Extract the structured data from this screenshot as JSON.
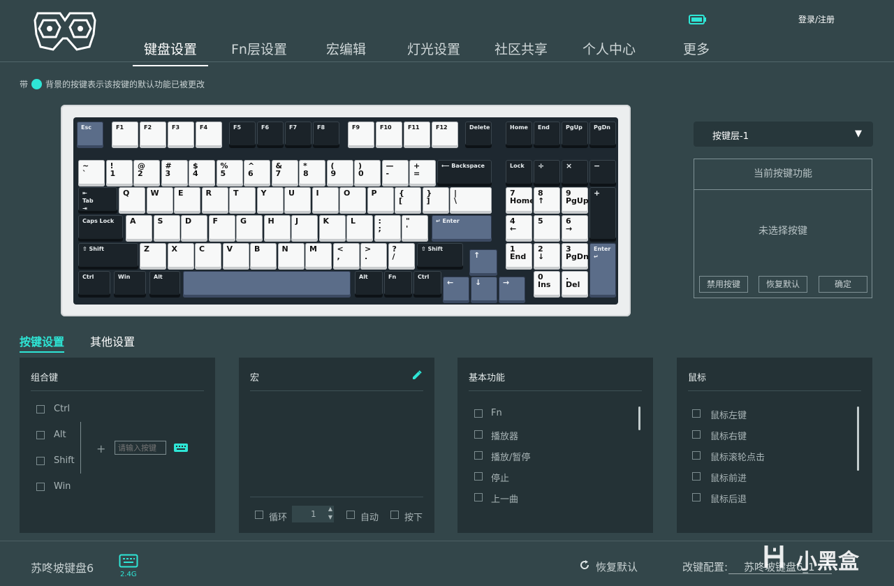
{
  "header": {
    "tabs": [
      {
        "label": "键盘设置",
        "active": true
      },
      {
        "label": "Fn层设置",
        "active": false
      },
      {
        "label": "宏编辑",
        "active": false
      },
      {
        "label": "灯光设置",
        "active": false
      },
      {
        "label": "社区共享",
        "active": false
      },
      {
        "label": "个人中心",
        "active": false
      },
      {
        "label": "更多",
        "active": false
      }
    ],
    "login": "登录/注册",
    "battery_icon": "battery-icon",
    "logo_icon": "logo-icon"
  },
  "notice": {
    "prefix": "带",
    "text": "背景的按键表示该按键的默认功能已被更改"
  },
  "keyboard": {
    "row_f": [
      "Esc",
      "F1",
      "F2",
      "F3",
      "F4",
      "F5",
      "F6",
      "F7",
      "F8",
      "F9",
      "F10",
      "F11",
      "F12",
      "Delete",
      "Home",
      "End",
      "PgUp",
      "PgDn"
    ],
    "row_num": [
      "~\n`",
      "!\n1",
      "@\n2",
      "#\n3",
      "$\n4",
      "%\n5",
      "^\n6",
      "&\n7",
      "*\n8",
      "(\n9",
      ")\n0",
      "—\n-",
      "+\n=",
      "⟵ Backspace"
    ],
    "row_q": [
      "⇤\nTab\n⇥",
      "Q",
      "W",
      "E",
      "R",
      "T",
      "Y",
      "U",
      "I",
      "O",
      "P",
      "{\n[",
      "}\n]",
      "|\n\\"
    ],
    "row_a": [
      "Caps Lock",
      "A",
      "S",
      "D",
      "F",
      "G",
      "H",
      "J",
      "K",
      "L",
      ":\n;",
      "\"\n'",
      "↵ Enter"
    ],
    "row_z": [
      "⇧ Shift",
      "Z",
      "X",
      "C",
      "V",
      "B",
      "N",
      "M",
      "<\n,",
      ">\n.",
      "?\n/",
      "⇧ Shift"
    ],
    "row_bottom": [
      "Ctrl",
      "Win",
      "Alt",
      "",
      "Alt",
      "Fn",
      "Ctrl"
    ],
    "arrows": [
      "↑",
      "←",
      "↓",
      "→"
    ],
    "numpad": [
      "Lock",
      "÷",
      "×",
      "−",
      "7\nHome",
      "8\n↑",
      "9\nPgUp",
      "+",
      "4\n←",
      "5",
      "6\n→",
      "1\nEnd",
      "2\n↓",
      "3\nPgDn",
      "Enter\n↵",
      "0\nIns",
      ".\nDel"
    ]
  },
  "right_panel": {
    "layer": "按键层-1",
    "layer_arrow": "▼",
    "func_title": "当前按键功能",
    "func_empty": "未选择按键",
    "buttons": [
      "禁用按键",
      "恢复默认",
      "确定"
    ]
  },
  "subtabs": [
    {
      "label": "按键设置",
      "active": true
    },
    {
      "label": "其他设置",
      "active": false
    }
  ],
  "combo": {
    "title": "组合键",
    "keys": [
      "Ctrl",
      "Alt",
      "Shift",
      "Win"
    ],
    "plus": "+",
    "placeholder": "请输入按键",
    "keyboard_icon": "keyboard-icon"
  },
  "macro": {
    "title": "宏",
    "edit_icon": "pencil-icon",
    "loop_label": "循环",
    "loop_value": "1",
    "auto_label": "自动",
    "press_label": "按下"
  },
  "basic": {
    "title": "基本功能",
    "items": [
      "Fn",
      "播放器",
      "播放/暂停",
      "停止",
      "上一曲"
    ]
  },
  "mouse": {
    "title": "鼠标",
    "items": [
      "鼠标左键",
      "鼠标右键",
      "鼠标滚轮点击",
      "鼠标前进",
      "鼠标后退"
    ]
  },
  "footer": {
    "device": "苏咚坡键盘6",
    "mode": "2.4G",
    "restore": "恢复默认",
    "config_label": "改键配置:",
    "config_value": "苏咚坡键盘6_1",
    "watermark": "小黑盒"
  },
  "colors": {
    "accent": "#2ee6d6",
    "bg": "#33464a",
    "panel": "#243236"
  }
}
